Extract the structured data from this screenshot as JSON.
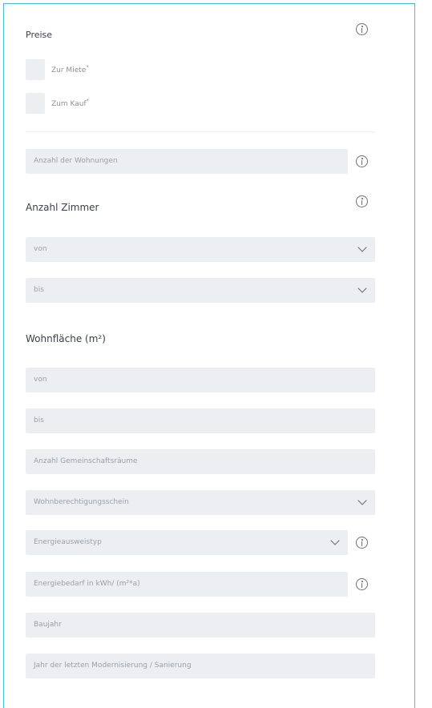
{
  "preise": {
    "title": "Preise",
    "options": [
      {
        "label": "Zur Miete",
        "required_mark": "*"
      },
      {
        "label": "Zum Kauf",
        "required_mark": "*"
      }
    ]
  },
  "wohnungen": {
    "placeholder": "Anzahl der Wohnungen"
  },
  "zimmer": {
    "title": "Anzahl Zimmer",
    "von": "von",
    "bis": "bis"
  },
  "wohnflaeche": {
    "title": "Wohnfläche (m²)",
    "von": "von",
    "bis": "bis"
  },
  "fields": {
    "gemeinschaftsraeume": "Anzahl Gemeinschaftsräume",
    "wohnberechtigungsschein": "Wohnberechtigungsschein",
    "energieausweistyp": "Energieausweistyp",
    "energiebedarf": "Energiebedarf in kWh/ (m²*a)",
    "baujahr": "Baujahr",
    "modernisierung": "Jahr der letzten Modernisierung / Sanierung"
  },
  "icons": {
    "info": "info-icon",
    "dropdown": "chevron-down-icon"
  },
  "colors": {
    "frame_border": "#49b9d3",
    "field_background": "#eceef2",
    "heading_text": "#3a3f45",
    "placeholder_text": "#9aa0a6"
  }
}
